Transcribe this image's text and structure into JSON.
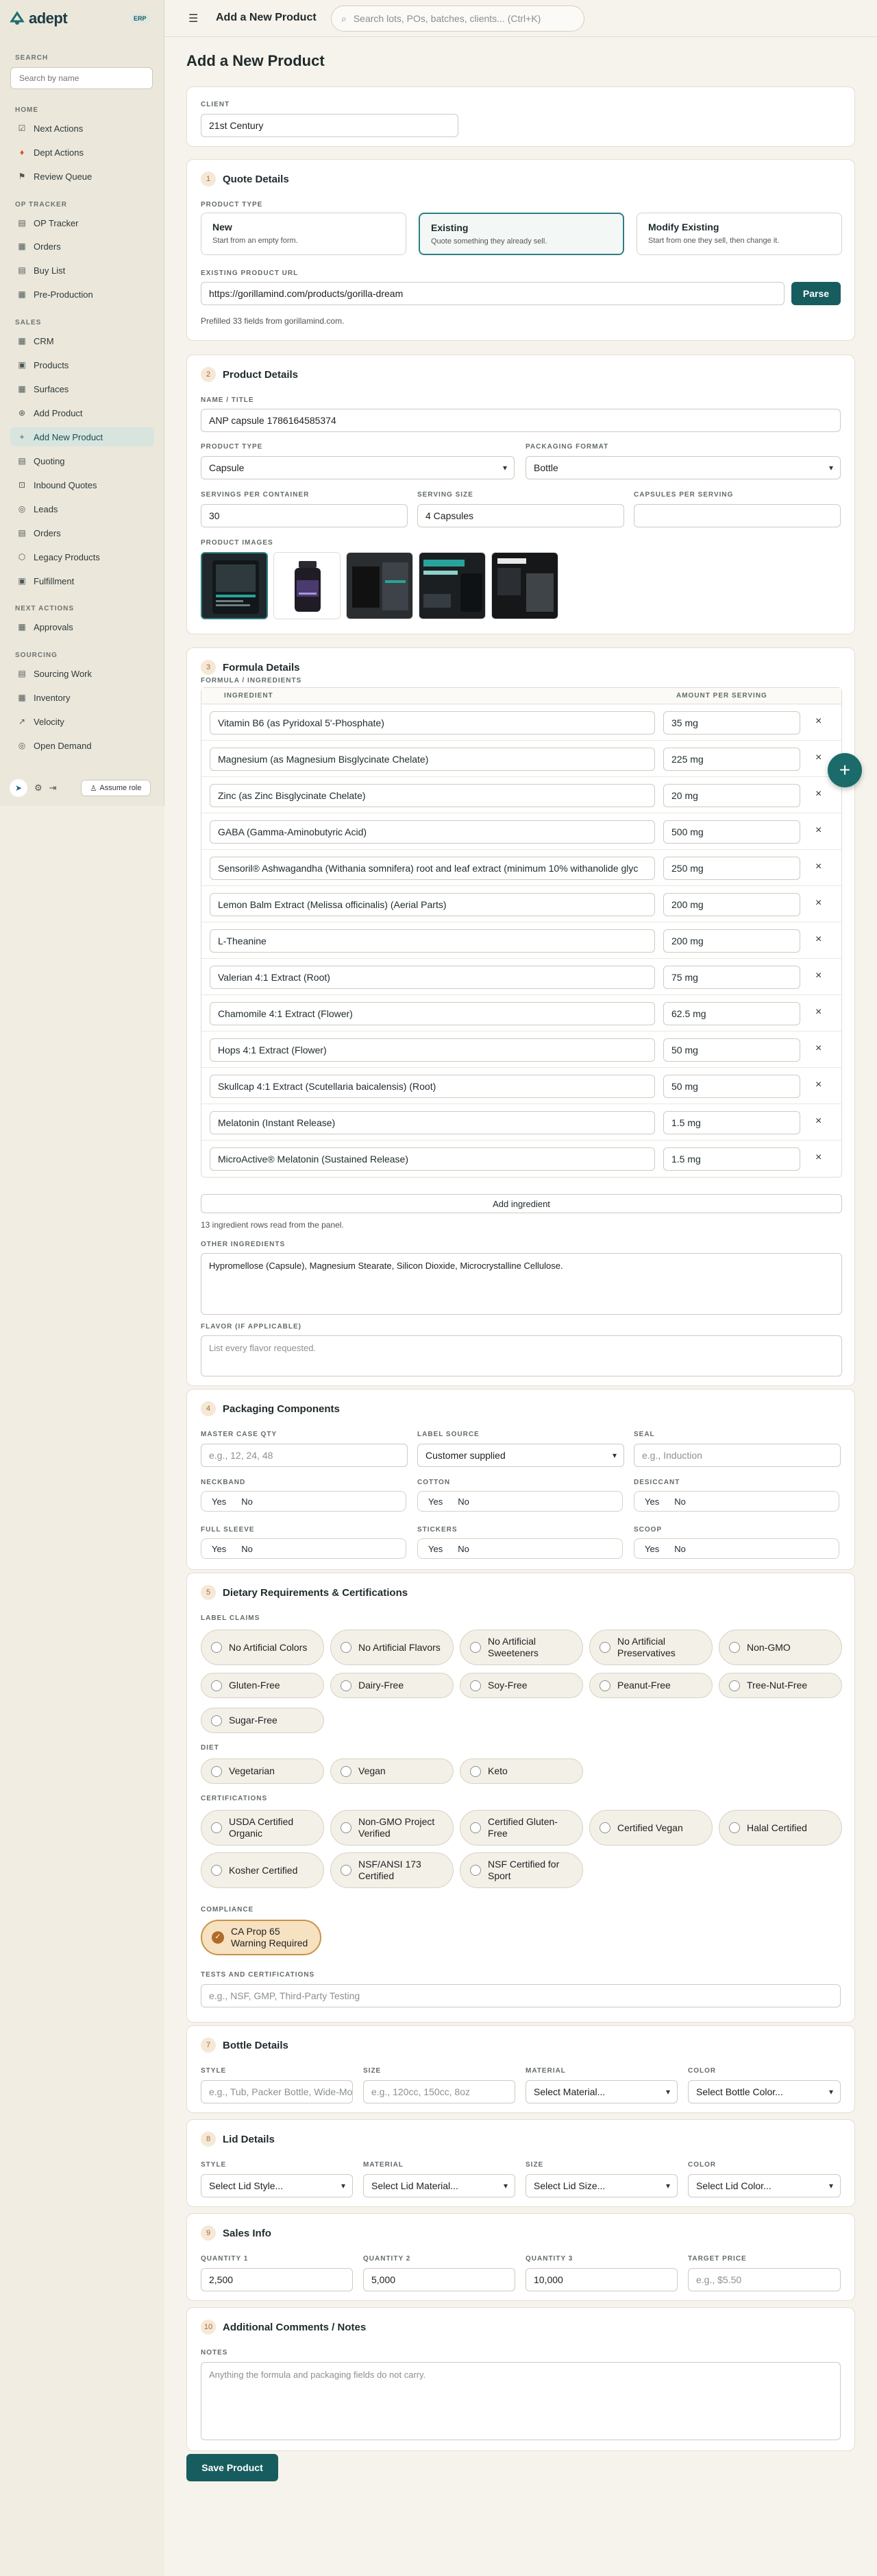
{
  "brand": {
    "name": "adept",
    "badge": "ERP"
  },
  "sidebar": {
    "search_label": "SEARCH",
    "search_placeholder": "Search by name",
    "sections": [
      {
        "label": "HOME",
        "items": [
          "Next Actions",
          "Dept Actions",
          "Review Queue"
        ]
      },
      {
        "label": "OP TRACKER",
        "items": [
          "OP Tracker",
          "Orders",
          "Buy List",
          "Pre-Production"
        ]
      },
      {
        "label": "SALES",
        "items": [
          "CRM",
          "Products",
          "Surfaces",
          "Add Product",
          "Add New Product",
          "Quoting",
          "Inbound Quotes",
          "Leads",
          "Orders",
          "Legacy Products",
          "Fulfillment"
        ]
      },
      {
        "label": "NEXT ACTIONS",
        "items": [
          "Approvals"
        ]
      },
      {
        "label": "SOURCING",
        "items": [
          "Sourcing Work",
          "Inventory",
          "Velocity",
          "Open Demand"
        ]
      }
    ],
    "assume_role": "Assume role"
  },
  "topbar": {
    "title": "Add a New Product",
    "search_placeholder": "Search lots, POs, batches, clients... (Ctrl+K)"
  },
  "page": {
    "title": "Add a New Product"
  },
  "client": {
    "label": "CLIENT",
    "value": "21st Century"
  },
  "quote": {
    "num": "1",
    "title": "Quote Details",
    "ptype_label": "PRODUCT TYPE",
    "types": [
      {
        "t": "New",
        "d": "Start from an empty form."
      },
      {
        "t": "Existing",
        "d": "Quote something they already sell."
      },
      {
        "t": "Modify Existing",
        "d": "Start from one they sell, then change it."
      }
    ],
    "url_label": "EXISTING PRODUCT URL",
    "url_value": "https://gorillamind.com/products/gorilla-dream",
    "parse": "Parse",
    "prefill_note": "Prefilled 33 fields from gorillamind.com."
  },
  "product": {
    "num": "2",
    "title": "Product Details",
    "name_label": "NAME / TITLE",
    "name_value": "ANP capsule 1786164585374",
    "type_label": "PRODUCT TYPE",
    "type_value": "Capsule",
    "pack_label": "PACKAGING FORMAT",
    "pack_value": "Bottle",
    "servings_label": "SERVINGS PER CONTAINER",
    "servings_value": "30",
    "size_label": "SERVING SIZE",
    "size_value": "4 Capsules",
    "caps_label": "CAPSULES PER SERVING",
    "caps_value": "",
    "images_label": "PRODUCT IMAGES"
  },
  "formula": {
    "num": "3",
    "title": "Formula Details",
    "label": "FORMULA / INGREDIENTS",
    "col_ing": "INGREDIENT",
    "col_amt": "AMOUNT PER SERVING",
    "rows": [
      {
        "name": "Vitamin B6 (as Pyridoxal 5'-Phosphate)",
        "amount": "35 mg"
      },
      {
        "name": "Magnesium (as Magnesium Bisglycinate Chelate)",
        "amount": "225 mg"
      },
      {
        "name": "Zinc (as Zinc Bisglycinate Chelate)",
        "amount": "20 mg"
      },
      {
        "name": "GABA (Gamma-Aminobutyric Acid)",
        "amount": "500 mg"
      },
      {
        "name": "Sensoril® Ashwagandha (Withania somnifera) root and leaf extract (minimum 10% withanolide glyc",
        "amount": "250 mg"
      },
      {
        "name": "Lemon Balm Extract (Melissa officinalis) (Aerial Parts)",
        "amount": "200 mg"
      },
      {
        "name": "L-Theanine",
        "amount": "200 mg"
      },
      {
        "name": "Valerian 4:1 Extract (Root)",
        "amount": "75 mg"
      },
      {
        "name": "Chamomile 4:1 Extract (Flower)",
        "amount": "62.5 mg"
      },
      {
        "name": "Hops 4:1 Extract (Flower)",
        "amount": "50 mg"
      },
      {
        "name": "Skullcap 4:1 Extract (Scutellaria baicalensis) (Root)",
        "amount": "50 mg"
      },
      {
        "name": "Melatonin (Instant Release)",
        "amount": "1.5 mg"
      },
      {
        "name": "MicroActive® Melatonin (Sustained Release)",
        "amount": "1.5 mg"
      }
    ],
    "add": "Add ingredient",
    "rows_note": "13 ingredient rows read from the panel.",
    "other_label": "OTHER INGREDIENTS",
    "other_value": "Hypromellose (Capsule), Magnesium Stearate, Silicon Dioxide, Microcrystalline Cellulose.",
    "flavor_label": "FLAVOR (IF APPLICABLE)",
    "flavor_placeholder": "List every flavor requested."
  },
  "packaging": {
    "num": "4",
    "title": "Packaging Components",
    "master_label": "MASTER CASE QTY",
    "master_ph": "e.g., 12, 24, 48",
    "label_src_label": "LABEL SOURCE",
    "label_src_value": "Customer supplied",
    "seal_label": "SEAL",
    "seal_ph": "e.g., Induction",
    "neckband": "NECKBAND",
    "cotton": "COTTON",
    "desiccant": "DESICCANT",
    "sleeve": "FULL SLEEVE",
    "stickers": "STICKERS",
    "scoop": "SCOOP",
    "yes": "Yes",
    "no": "No"
  },
  "dietary": {
    "num": "5",
    "title": "Dietary Requirements & Certifications",
    "claims_label": "LABEL CLAIMS",
    "claims": [
      "No Artificial Colors",
      "No Artificial Flavors",
      "No Artificial Sweeteners",
      "No Artificial Preservatives",
      "Non-GMO",
      "Gluten-Free",
      "Dairy-Free",
      "Soy-Free",
      "Peanut-Free",
      "Tree-Nut-Free",
      "Sugar-Free"
    ],
    "diet_label": "DIET",
    "diet": [
      "Vegetarian",
      "Vegan",
      "Keto"
    ],
    "certs_label": "CERTIFICATIONS",
    "certs": [
      "USDA Certified Organic",
      "Non-GMO Project Verified",
      "Certified Gluten-Free",
      "Certified Vegan",
      "Halal Certified",
      "Kosher Certified",
      "NSF/ANSI 173 Certified",
      "NSF Certified for Sport"
    ],
    "compliance_label": "COMPLIANCE",
    "compliance": "CA Prop 65 Warning Required",
    "tests_label": "TESTS AND CERTIFICATIONS",
    "tests_ph": "e.g., NSF, GMP, Third-Party Testing"
  },
  "bottle": {
    "num": "7",
    "title": "Bottle Details",
    "style_label": "STYLE",
    "style_ph": "e.g., Tub, Packer Bottle, Wide-Mouth",
    "size_label": "SIZE",
    "size_ph": "e.g., 120cc, 150cc, 8oz",
    "material_label": "MATERIAL",
    "material_value": "Select Material...",
    "color_label": "COLOR",
    "color_value": "Select Bottle Color..."
  },
  "lid": {
    "num": "8",
    "title": "Lid Details",
    "style_label": "STYLE",
    "style_value": "Select Lid Style...",
    "material_label": "MATERIAL",
    "material_value": "Select Lid Material...",
    "size_label": "SIZE",
    "size_value": "Select Lid Size...",
    "color_label": "COLOR",
    "color_value": "Select Lid Color..."
  },
  "sales": {
    "num": "9",
    "title": "Sales Info",
    "q1_label": "QUANTITY 1",
    "q1": "2,500",
    "q2_label": "QUANTITY 2",
    "q2": "5,000",
    "q3_label": "QUANTITY 3",
    "q3": "10,000",
    "tp_label": "TARGET PRICE",
    "tp_ph": "e.g., $5.50"
  },
  "comments": {
    "num": "10",
    "title": "Additional Comments / Notes",
    "notes_label": "NOTES",
    "notes_ph": "Anything the formula and packaging fields do not carry."
  },
  "save": "Save Product"
}
